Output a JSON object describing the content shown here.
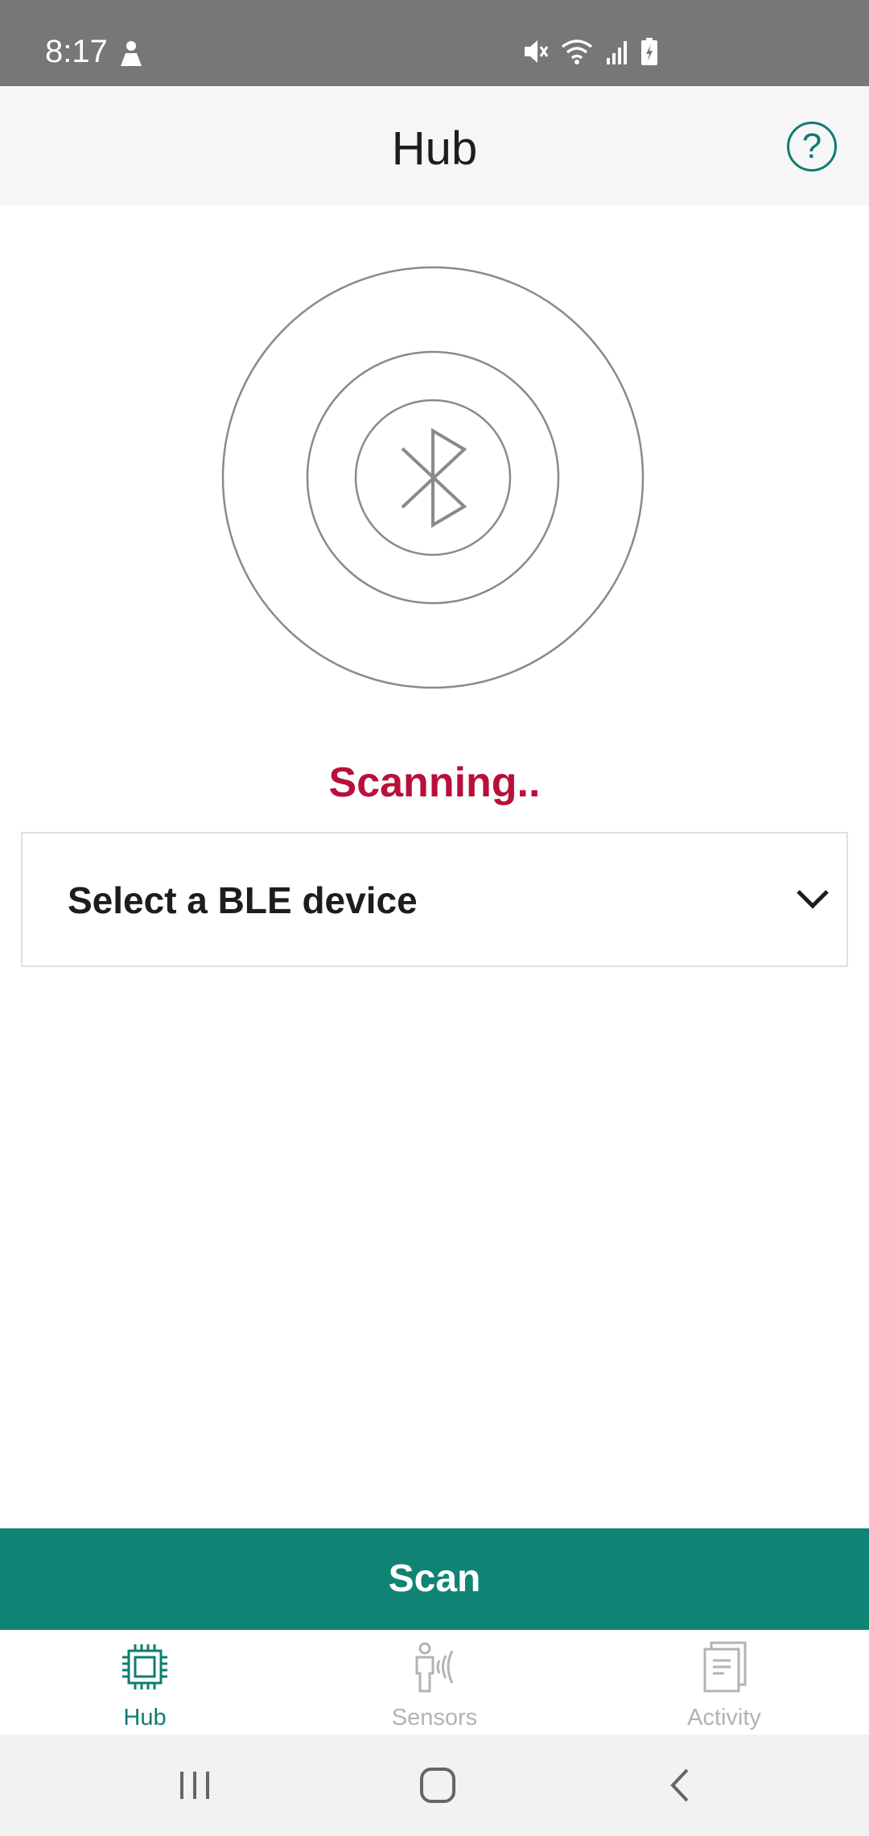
{
  "status_bar": {
    "time": "8:17",
    "icons": [
      "person-notification-icon",
      "mute-icon",
      "wifi-icon",
      "signal-icon",
      "battery-charging-icon"
    ]
  },
  "app_bar": {
    "title": "Hub",
    "help_label": "?"
  },
  "radar": {
    "icon": "bluetooth-icon"
  },
  "scan_status": "Scanning..",
  "device_select": {
    "label": "Select a BLE device"
  },
  "scan_button": {
    "label": "Scan"
  },
  "bottom_nav": {
    "items": [
      {
        "label": "Hub",
        "icon": "chip-icon",
        "active": true
      },
      {
        "label": "Sensors",
        "icon": "sensor-person-icon",
        "active": false
      },
      {
        "label": "Activity",
        "icon": "document-icon",
        "active": false
      }
    ]
  },
  "system_nav": {
    "buttons": [
      "recent-apps",
      "home",
      "back"
    ]
  },
  "colors": {
    "accent": "#0f8474",
    "scanning": "#b8103a",
    "status_bar": "#777777"
  }
}
